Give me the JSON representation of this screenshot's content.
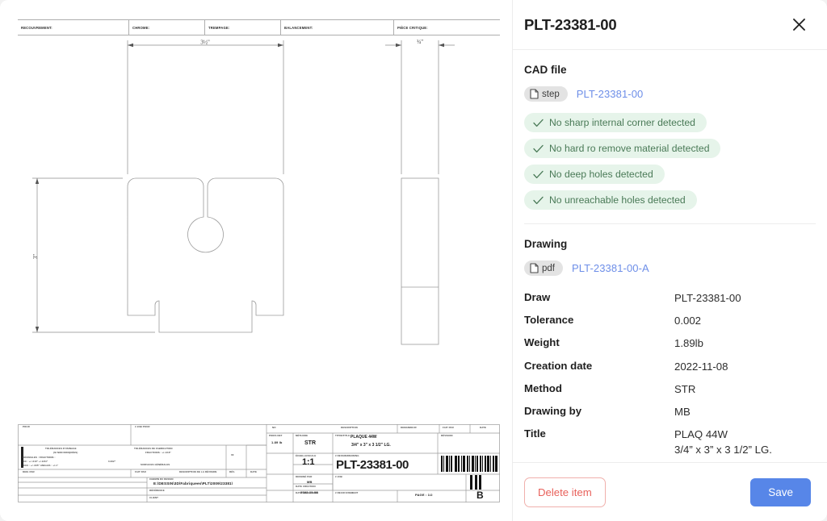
{
  "panel": {
    "title": "PLT-23381-00",
    "close_icon": "close-icon",
    "cad": {
      "section_label": "CAD file",
      "chip_label": "step",
      "chip_icon": "file-icon",
      "file_link": "PLT-23381-00",
      "checks": [
        {
          "icon": "check-icon",
          "label": "No sharp internal corner detected"
        },
        {
          "icon": "check-icon",
          "label": "No hard ro remove material detected"
        },
        {
          "icon": "check-icon",
          "label": "No deep holes detected"
        },
        {
          "icon": "check-icon",
          "label": "No unreachable holes detected"
        }
      ]
    },
    "drawing": {
      "section_label": "Drawing",
      "chip_label": "pdf",
      "chip_icon": "file-icon",
      "file_link": "PLT-23381-00-A",
      "properties": [
        {
          "key": "Draw",
          "value": "PLT-23381-00"
        },
        {
          "key": "Tolerance",
          "value": "0.002"
        },
        {
          "key": "Weight",
          "value": "1.89lb"
        },
        {
          "key": "Creation date",
          "value": "2022-11-08"
        },
        {
          "key": "Method",
          "value": "STR"
        },
        {
          "key": "Drawing by",
          "value": "MB"
        },
        {
          "key": "Title",
          "value": "PLAQ 44W\n3/4” x 3” x 3 1/2” LG."
        }
      ]
    },
    "footer": {
      "delete_label": "Delete item",
      "save_label": "Save"
    }
  },
  "colors": {
    "accent_blue": "#5786e8",
    "link_blue": "#6d8ee8",
    "badge_bg": "#e6f4ea",
    "badge_text": "#4a7a57",
    "danger": "#e8615b",
    "panel_bg": "#ffffff",
    "page_bg": "#f2f2f2"
  },
  "drawing_sheet": {
    "attributes": [
      "RECOUVREMENT:",
      "CHROME:",
      "TREMPAGE:",
      "BALANCEMENT:",
      "PIÈCE CRITIQUE:"
    ],
    "dimensions": {
      "width_label": "3½\"",
      "height_label": "3\"",
      "thickness_label": "¾\""
    },
    "title_block": {
      "col_no": "NO",
      "col_description": "DESCRIPTION",
      "col_demandeur": "DEMANDEUR",
      "col_fait_par": "FAIT PAR",
      "col_date": "DATE",
      "poids_net_label": "POIDS NET",
      "poids_net_value": "1.89 lb",
      "methode_label": "MÉTHODE",
      "methode_value": "STR",
      "titre_label": "TITRE/TITLE",
      "titre_value_1": "PLAQUE 44W",
      "titre_value_2": "3/4\" x 3\" x 3 1/2\" LG.",
      "echelle_label": "ÉCHELLE/SCALE",
      "echelle_value": "1:1",
      "no_dessin_label": "# DESSIN/DRAWING",
      "no_dessin_value": "PLT-23381-00",
      "dessine_par_label": "DESSINÉ PAR",
      "dessine_par_value": "MB",
      "date_creation_label": "DATE CRÉATION",
      "date_creation_value": "2022-11-08",
      "date_impression_label": "DATE IMPRESSION",
      "recouvrement_label": "# RECOUVREMENT",
      "no_job_label": "# JOB",
      "revision_label": "RÉVISION",
      "page_label": "PAGE : 1/2",
      "revision_value": "B",
      "tol_usinage_title": "TOLÉRANCES D'USINAGE",
      "tol_usinage_sub": "(SI NON INDIQUÉES)",
      "tol_fabrication_title": "TOLÉRANCES DE FABRICATION",
      "tol_fabrication_sub": "FRACTIONS : +/-1/16\"",
      "surfaces_label": "SURFACES GÉNÉRALES",
      "decimales_label": "DÉCIMALES :  FRACTIONS :",
      "decimales_l2": ".XX : +/-.010\"    +/-1/64\"",
      "decimales_l3": ".XXX : +/-.005\"    ANGLES : +/-1°",
      "angle_label": "0.002\"",
      "chemin_label": "CHEMIN DU DESSIN",
      "chemin_value": "E:\\DESSIN\\3D\\Fabriquees\\PLT\\2009\\23381\\",
      "reference_label": "RÉFÉRENCE",
      "client_label": "CLIENT",
      "date_col_label": "DATE",
      "desc_revision_label": "DESCRIPTION DE LA RÉVISION",
      "dem_par_label": "DEM. PAR",
      "fait_par_label": "FAIT PAR",
      "rev_label": "RÉV.",
      "pour_label": "POUR",
      "job_pour_label": "# JOB POUR",
      "rev_num": "00"
    }
  }
}
